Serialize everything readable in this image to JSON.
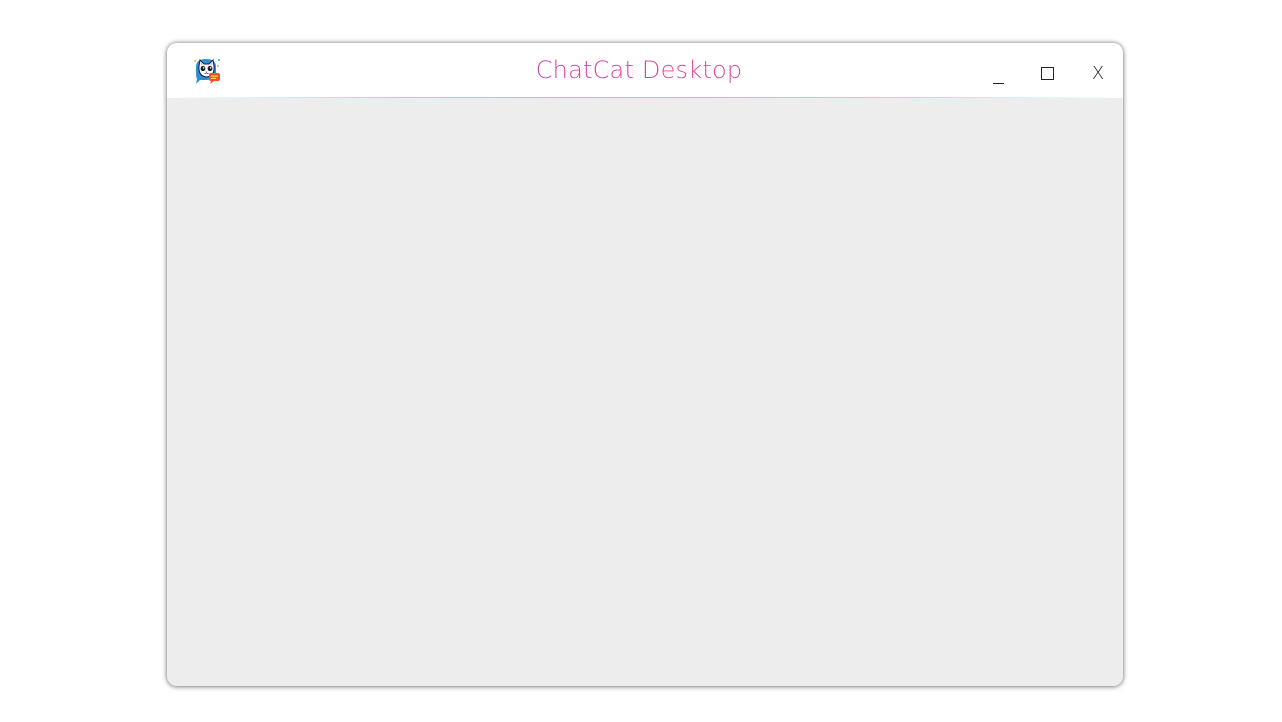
{
  "window": {
    "title": "ChatCat Desktop",
    "app_icon": "chatcat-logo-icon",
    "controls": {
      "minimize_label": "_",
      "maximize_icon": "maximize-icon",
      "close_label": "X"
    }
  },
  "colors": {
    "title_gradient": [
      "#4a9fd8",
      "#d03fa6",
      "#16c1c4"
    ],
    "content_background": "#ededed",
    "titlebar_background": "#ffffff"
  }
}
